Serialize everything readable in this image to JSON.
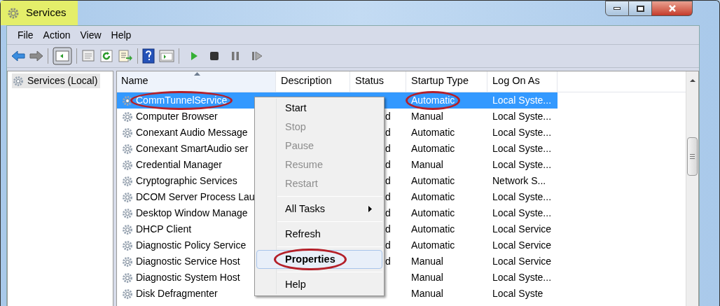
{
  "window": {
    "title": "Services",
    "title_highlighted": true
  },
  "menu_bar": [
    "File",
    "Action",
    "View",
    "Help"
  ],
  "tree": {
    "items": [
      {
        "label": "Services (Local)",
        "selected": true
      }
    ]
  },
  "table": {
    "columns": [
      {
        "label": "Name",
        "sorted": true
      },
      {
        "label": "Description",
        "sorted": false
      },
      {
        "label": "Status",
        "sorted": false
      },
      {
        "label": "Startup Type",
        "sorted": false
      },
      {
        "label": "Log On As",
        "sorted": false
      }
    ],
    "rows": [
      {
        "name": "CommTunnelService",
        "startup": "Automatic",
        "logon": "Local Syste...",
        "selected": true,
        "name_circled": true,
        "startup_circled": true
      },
      {
        "name": "Computer Browser",
        "status": "d",
        "startup": "Manual",
        "logon": "Local Syste...",
        "selected": false,
        "name_circled": false,
        "startup_circled": false
      },
      {
        "name": "Conexant Audio Message",
        "status": "d",
        "startup": "Automatic",
        "logon": "Local Syste...",
        "selected": false,
        "name_circled": false,
        "startup_circled": false
      },
      {
        "name": "Conexant SmartAudio ser",
        "status": "d",
        "startup": "Automatic",
        "logon": "Local Syste...",
        "selected": false,
        "name_circled": false,
        "startup_circled": false
      },
      {
        "name": "Credential Manager",
        "status": "d",
        "startup": "Manual",
        "logon": "Local Syste...",
        "selected": false,
        "name_circled": false,
        "startup_circled": false
      },
      {
        "name": "Cryptographic Services",
        "status": "d",
        "startup": "Automatic",
        "logon": "Network S...",
        "selected": false,
        "name_circled": false,
        "startup_circled": false
      },
      {
        "name": "DCOM Server Process Lau",
        "status": "d",
        "startup": "Automatic",
        "logon": "Local Syste...",
        "selected": false,
        "name_circled": false,
        "startup_circled": false
      },
      {
        "name": "Desktop Window Manage",
        "status": "d",
        "startup": "Automatic",
        "logon": "Local Syste...",
        "selected": false,
        "name_circled": false,
        "startup_circled": false
      },
      {
        "name": "DHCP Client",
        "status": "d",
        "startup": "Automatic",
        "logon": "Local Service",
        "selected": false,
        "name_circled": false,
        "startup_circled": false
      },
      {
        "name": "Diagnostic Policy Service",
        "status": "d",
        "startup": "Automatic",
        "logon": "Local Service",
        "selected": false,
        "name_circled": false,
        "startup_circled": false
      },
      {
        "name": "Diagnostic Service Host",
        "status": "d",
        "startup": "Manual",
        "logon": "Local Service",
        "selected": false,
        "name_circled": false,
        "startup_circled": false
      },
      {
        "name": "Diagnostic System Host",
        "startup": "Manual",
        "logon": "Local Syste...",
        "selected": false,
        "name_circled": false,
        "startup_circled": false
      },
      {
        "name": "Disk Defragmenter",
        "startup": "Manual",
        "logon": "Local Syste",
        "selected": false,
        "name_circled": false,
        "startup_circled": false
      }
    ]
  },
  "context_menu": [
    {
      "kind": "item",
      "label": "Start",
      "disabled": false,
      "selected": false,
      "bold": false,
      "circled": false
    },
    {
      "kind": "item",
      "label": "Stop",
      "disabled": true,
      "selected": false,
      "bold": false,
      "circled": false
    },
    {
      "kind": "item",
      "label": "Pause",
      "disabled": true,
      "selected": false,
      "bold": false,
      "circled": false
    },
    {
      "kind": "item",
      "label": "Resume",
      "disabled": true,
      "selected": false,
      "bold": false,
      "circled": false
    },
    {
      "kind": "item",
      "label": "Restart",
      "disabled": true,
      "selected": false,
      "bold": false,
      "circled": false
    },
    {
      "kind": "separator"
    },
    {
      "kind": "submenu",
      "label": "All Tasks",
      "disabled": false,
      "selected": false,
      "bold": false,
      "circled": false
    },
    {
      "kind": "separator"
    },
    {
      "kind": "item",
      "label": "Refresh",
      "disabled": false,
      "selected": false,
      "bold": false,
      "circled": false
    },
    {
      "kind": "separator"
    },
    {
      "kind": "item",
      "label": "Properties",
      "disabled": false,
      "selected": true,
      "bold": true,
      "circled": true
    },
    {
      "kind": "separator"
    },
    {
      "kind": "item",
      "label": "Help",
      "disabled": false,
      "selected": false,
      "bold": false,
      "circled": false
    }
  ]
}
